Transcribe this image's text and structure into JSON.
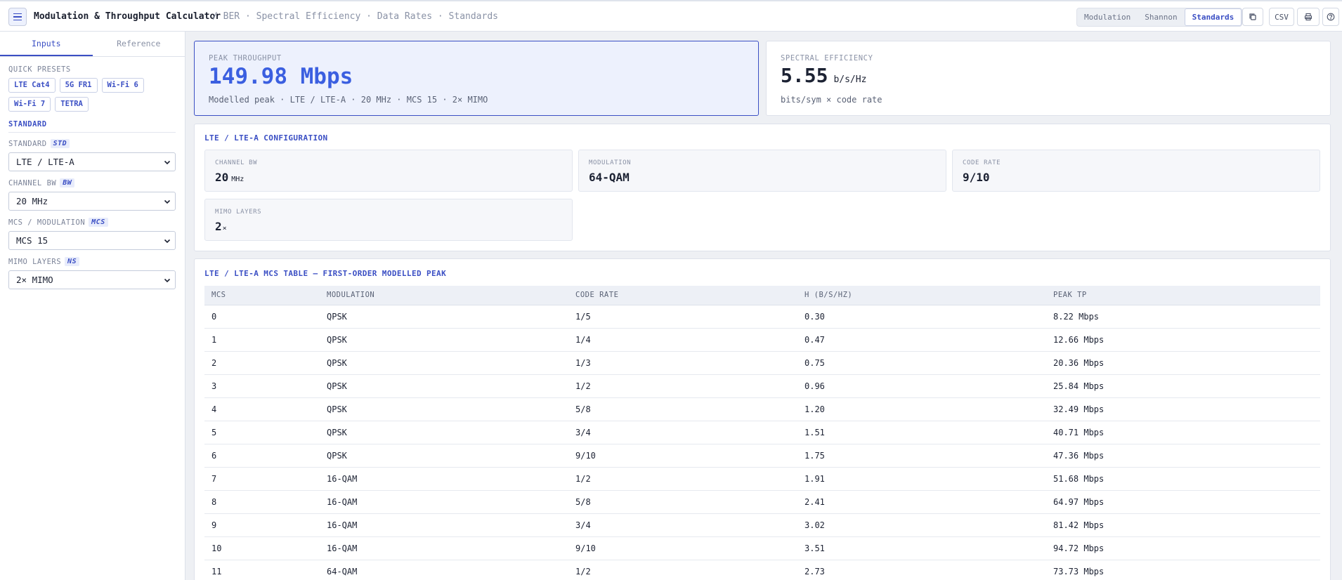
{
  "header": {
    "app_title": "Modulation & Throughput Calculator",
    "breadcrumb": "/ BER · Spectral Efficiency · Data Rates · Standards",
    "mode_tabs": [
      "Modulation",
      "Shannon",
      "Standards"
    ],
    "active_mode": "Standards",
    "csv_label": "CSV"
  },
  "sidebar": {
    "tabs": [
      "Inputs",
      "Reference"
    ],
    "quick_presets_label": "QUICK PRESETS",
    "presets": [
      "LTE Cat4",
      "5G FR1",
      "Wi-Fi 6",
      "Wi-Fi 7",
      "TETRA"
    ],
    "section_label": "STANDARD",
    "fields": {
      "standard": {
        "label": "STANDARD",
        "tag": "STD",
        "value": "LTE / LTE-A"
      },
      "channel_bw": {
        "label": "CHANNEL BW",
        "tag": "BW",
        "value": "20 MHz"
      },
      "mcs": {
        "label": "MCS / MODULATION",
        "tag": "MCS",
        "value": "MCS 15"
      },
      "mimo": {
        "label": "MIMO LAYERS",
        "tag": "NS",
        "value": "2× MIMO"
      }
    }
  },
  "summary": {
    "peak": {
      "label": "PEAK THROUGHPUT",
      "value": "149.98 Mbps",
      "sub": "Modelled peak · LTE / LTE-A · 20 MHz · MCS 15 · 2× MIMO"
    },
    "efficiency": {
      "label": "SPECTRAL EFFICIENCY",
      "value": "5.55",
      "unit": "b/s/Hz",
      "sub": "bits/sym × code rate"
    }
  },
  "config": {
    "title": "LTE / LTE-A CONFIGURATION",
    "channel_bw": {
      "label": "CHANNEL BW",
      "value": "20",
      "unit": "MHz"
    },
    "modulation": {
      "label": "MODULATION",
      "value": "64-QAM"
    },
    "code_rate": {
      "label": "CODE RATE",
      "value": "9/10"
    },
    "mimo_layers": {
      "label": "MIMO LAYERS",
      "value": "2",
      "unit": "×"
    }
  },
  "mcs_table": {
    "title": "LTE / LTE-A MCS TABLE — FIRST-ORDER MODELLED PEAK",
    "columns": [
      "MCS",
      "MODULATION",
      "CODE RATE",
      "Η (B/S/HZ)",
      "PEAK TP"
    ],
    "rows": [
      [
        "0",
        "QPSK",
        "1/5",
        "0.30",
        "8.22 Mbps"
      ],
      [
        "1",
        "QPSK",
        "1/4",
        "0.47",
        "12.66 Mbps"
      ],
      [
        "2",
        "QPSK",
        "1/3",
        "0.75",
        "20.36 Mbps"
      ],
      [
        "3",
        "QPSK",
        "1/2",
        "0.96",
        "25.84 Mbps"
      ],
      [
        "4",
        "QPSK",
        "5/8",
        "1.20",
        "32.49 Mbps"
      ],
      [
        "5",
        "QPSK",
        "3/4",
        "1.51",
        "40.71 Mbps"
      ],
      [
        "6",
        "QPSK",
        "9/10",
        "1.75",
        "47.36 Mbps"
      ],
      [
        "7",
        "16-QAM",
        "1/2",
        "1.91",
        "51.68 Mbps"
      ],
      [
        "8",
        "16-QAM",
        "5/8",
        "2.41",
        "64.97 Mbps"
      ],
      [
        "9",
        "16-QAM",
        "3/4",
        "3.02",
        "81.42 Mbps"
      ],
      [
        "10",
        "16-QAM",
        "9/10",
        "3.51",
        "94.72 Mbps"
      ],
      [
        "11",
        "64-QAM",
        "1/2",
        "2.73",
        "73.73 Mbps"
      ]
    ]
  },
  "colors": {
    "accent": "#3b4fc4",
    "peak_value": "#3b5fe0"
  }
}
